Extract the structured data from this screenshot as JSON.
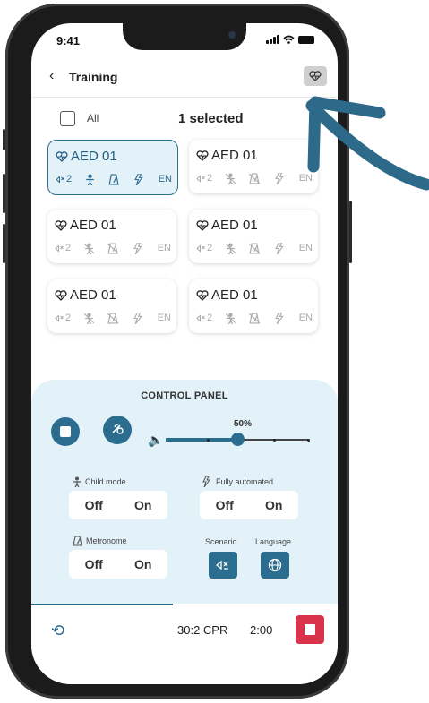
{
  "status": {
    "time": "9:41"
  },
  "header": {
    "back_icon": "chevron-left-icon",
    "title": "Training",
    "action_icon": "heart-pulse-icon"
  },
  "selection": {
    "all_label": "All",
    "count_text": "1 selected"
  },
  "devices": [
    {
      "name": "AED 01",
      "scenario": "2",
      "language": "EN",
      "selected": true
    },
    {
      "name": "AED 01",
      "scenario": "2",
      "language": "EN",
      "selected": false
    },
    {
      "name": "AED 01",
      "scenario": "2",
      "language": "EN",
      "selected": false
    },
    {
      "name": "AED 01",
      "scenario": "2",
      "language": "EN",
      "selected": false
    },
    {
      "name": "AED 01",
      "scenario": "2",
      "language": "EN",
      "selected": false
    },
    {
      "name": "AED 01",
      "scenario": "2",
      "language": "EN",
      "selected": false
    }
  ],
  "control_panel": {
    "title": "CONTROL PANEL",
    "volume": {
      "label": "50%",
      "value": 0.5
    },
    "child_mode": {
      "label": "Child mode",
      "off": "Off",
      "on": "On"
    },
    "fully_automated": {
      "label": "Fully automated",
      "off": "Off",
      "on": "On"
    },
    "metronome": {
      "label": "Metronome",
      "off": "Off",
      "on": "On"
    },
    "scenario": {
      "label": "Scenario"
    },
    "language": {
      "label": "Language"
    }
  },
  "bottom_bar": {
    "mode": "30:2 CPR",
    "timer": "2:00"
  },
  "colors": {
    "accent": "#2a6d8f",
    "panel": "#e3f1f8",
    "stop": "#d8334a",
    "arrow": "#2d6a8a"
  }
}
